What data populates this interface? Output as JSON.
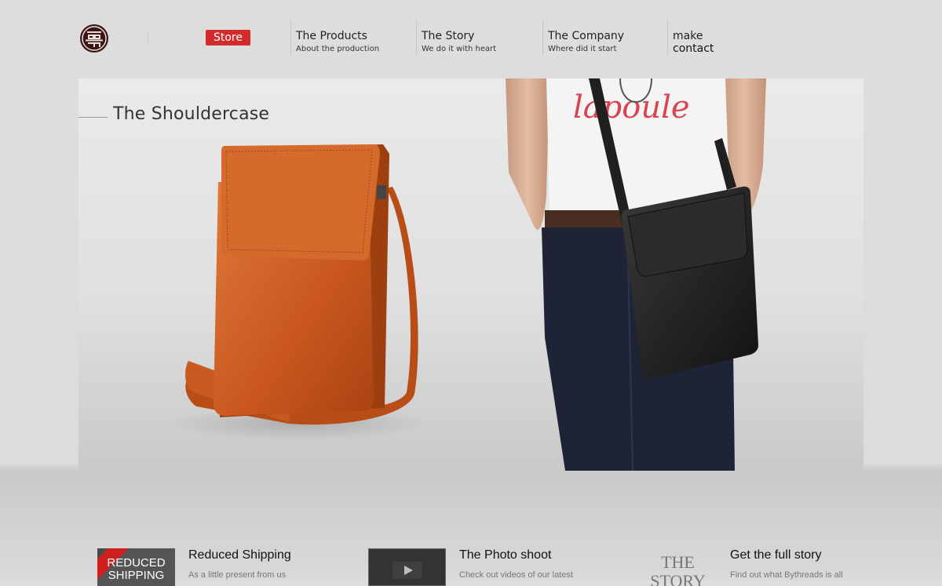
{
  "logo": {
    "icon": "shou-symbol-icon"
  },
  "nav": {
    "store_label": "Store",
    "items": [
      {
        "title": "The Products",
        "subtitle": "About the production"
      },
      {
        "title": "The Story",
        "subtitle": "We do it with heart"
      },
      {
        "title": "The Company",
        "subtitle": "Where did it start"
      }
    ],
    "contact": {
      "line1": "make",
      "line2": "contact"
    }
  },
  "hero": {
    "title": "The Shouldercase",
    "shirt_text": "lapoule",
    "colors": {
      "orange_bag": "#c8561e",
      "black_bag": "#1e1e1e"
    }
  },
  "features": [
    {
      "thumb_text_1": "REDUCED",
      "thumb_text_2": "SHIPPING",
      "title": "Reduced Shipping",
      "desc": "As a little present from us"
    },
    {
      "thumb_icon": "play-icon",
      "title": "The Photo shoot",
      "desc": "Check out videos of our latest"
    },
    {
      "thumb_text_1": "THE",
      "thumb_text_2": "STORY",
      "title": "Get the full story",
      "desc": "Find out what Bythreads is all"
    }
  ],
  "colors": {
    "accent": "#d32b2b",
    "background": "#dddddd"
  }
}
